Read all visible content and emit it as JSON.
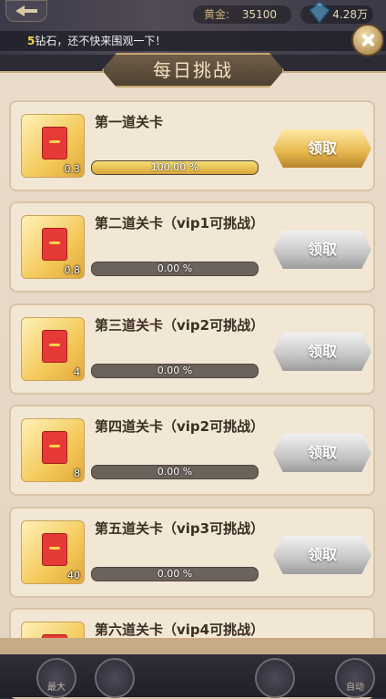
{
  "header": {
    "gold_label": "黄金:",
    "gold_value": "35100",
    "diamond_value": "4.28万"
  },
  "notice": {
    "highlight": "5",
    "text": "钻石，还不快来围观一下！"
  },
  "panel": {
    "title": "每日挑战"
  },
  "challenges": [
    {
      "name": "第一道关卡",
      "qty": "0.3",
      "progress_text": "100.00 %",
      "progress": 1.0,
      "button": "领取",
      "state": "active"
    },
    {
      "name": "第二道关卡（vip1可挑战）",
      "qty": "0.8",
      "progress_text": "0.00 %",
      "progress": 0.0,
      "button": "领取",
      "state": "disabled"
    },
    {
      "name": "第三道关卡（vip2可挑战）",
      "qty": "4",
      "progress_text": "0.00 %",
      "progress": 0.0,
      "button": "领取",
      "state": "disabled"
    },
    {
      "name": "第四道关卡（vip2可挑战）",
      "qty": "8",
      "progress_text": "0.00 %",
      "progress": 0.0,
      "button": "领取",
      "state": "disabled"
    },
    {
      "name": "第五道关卡（vip3可挑战）",
      "qty": "40",
      "progress_text": "0.00 %",
      "progress": 0.0,
      "button": "领取",
      "state": "disabled"
    },
    {
      "name": "第六道关卡（vip4可挑战）",
      "qty": "",
      "progress_text": "",
      "progress": 0.0,
      "button": "",
      "state": "disabled"
    }
  ],
  "bottom_nav": {
    "left_label": "最大",
    "right_label": "自动"
  }
}
